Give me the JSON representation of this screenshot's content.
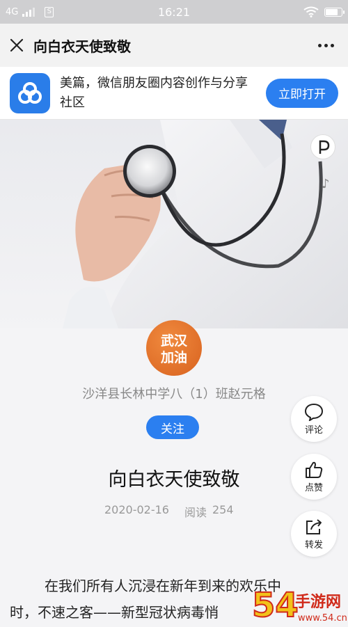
{
  "status_bar": {
    "network": "4G",
    "sim": "S",
    "time": "16:21",
    "battery_level": 0.8
  },
  "nav": {
    "title": "向白衣天使致敬"
  },
  "banner": {
    "app_text": "美篇，微信朋友圈内容创作与分享社区",
    "open_label": "立即打开",
    "accent": "#2b7ff0"
  },
  "avatar": {
    "text": "武汉加油"
  },
  "article": {
    "author": "沙洋县长林中学八（1）班赵元格",
    "follow_label": "关注",
    "title": "向白衣天使致敬",
    "date": "2020-02-16",
    "read_label": "阅读",
    "read_count": "254",
    "body_line1": "在我们所有人沉浸在新年到来的欢乐中",
    "body_line2": "时，不速之客——新型冠状病毒悄"
  },
  "side_actions": {
    "comment": "评论",
    "like": "点赞",
    "share": "转发"
  },
  "watermark": {
    "text": "54手游网",
    "domain": "www.54.cn"
  }
}
